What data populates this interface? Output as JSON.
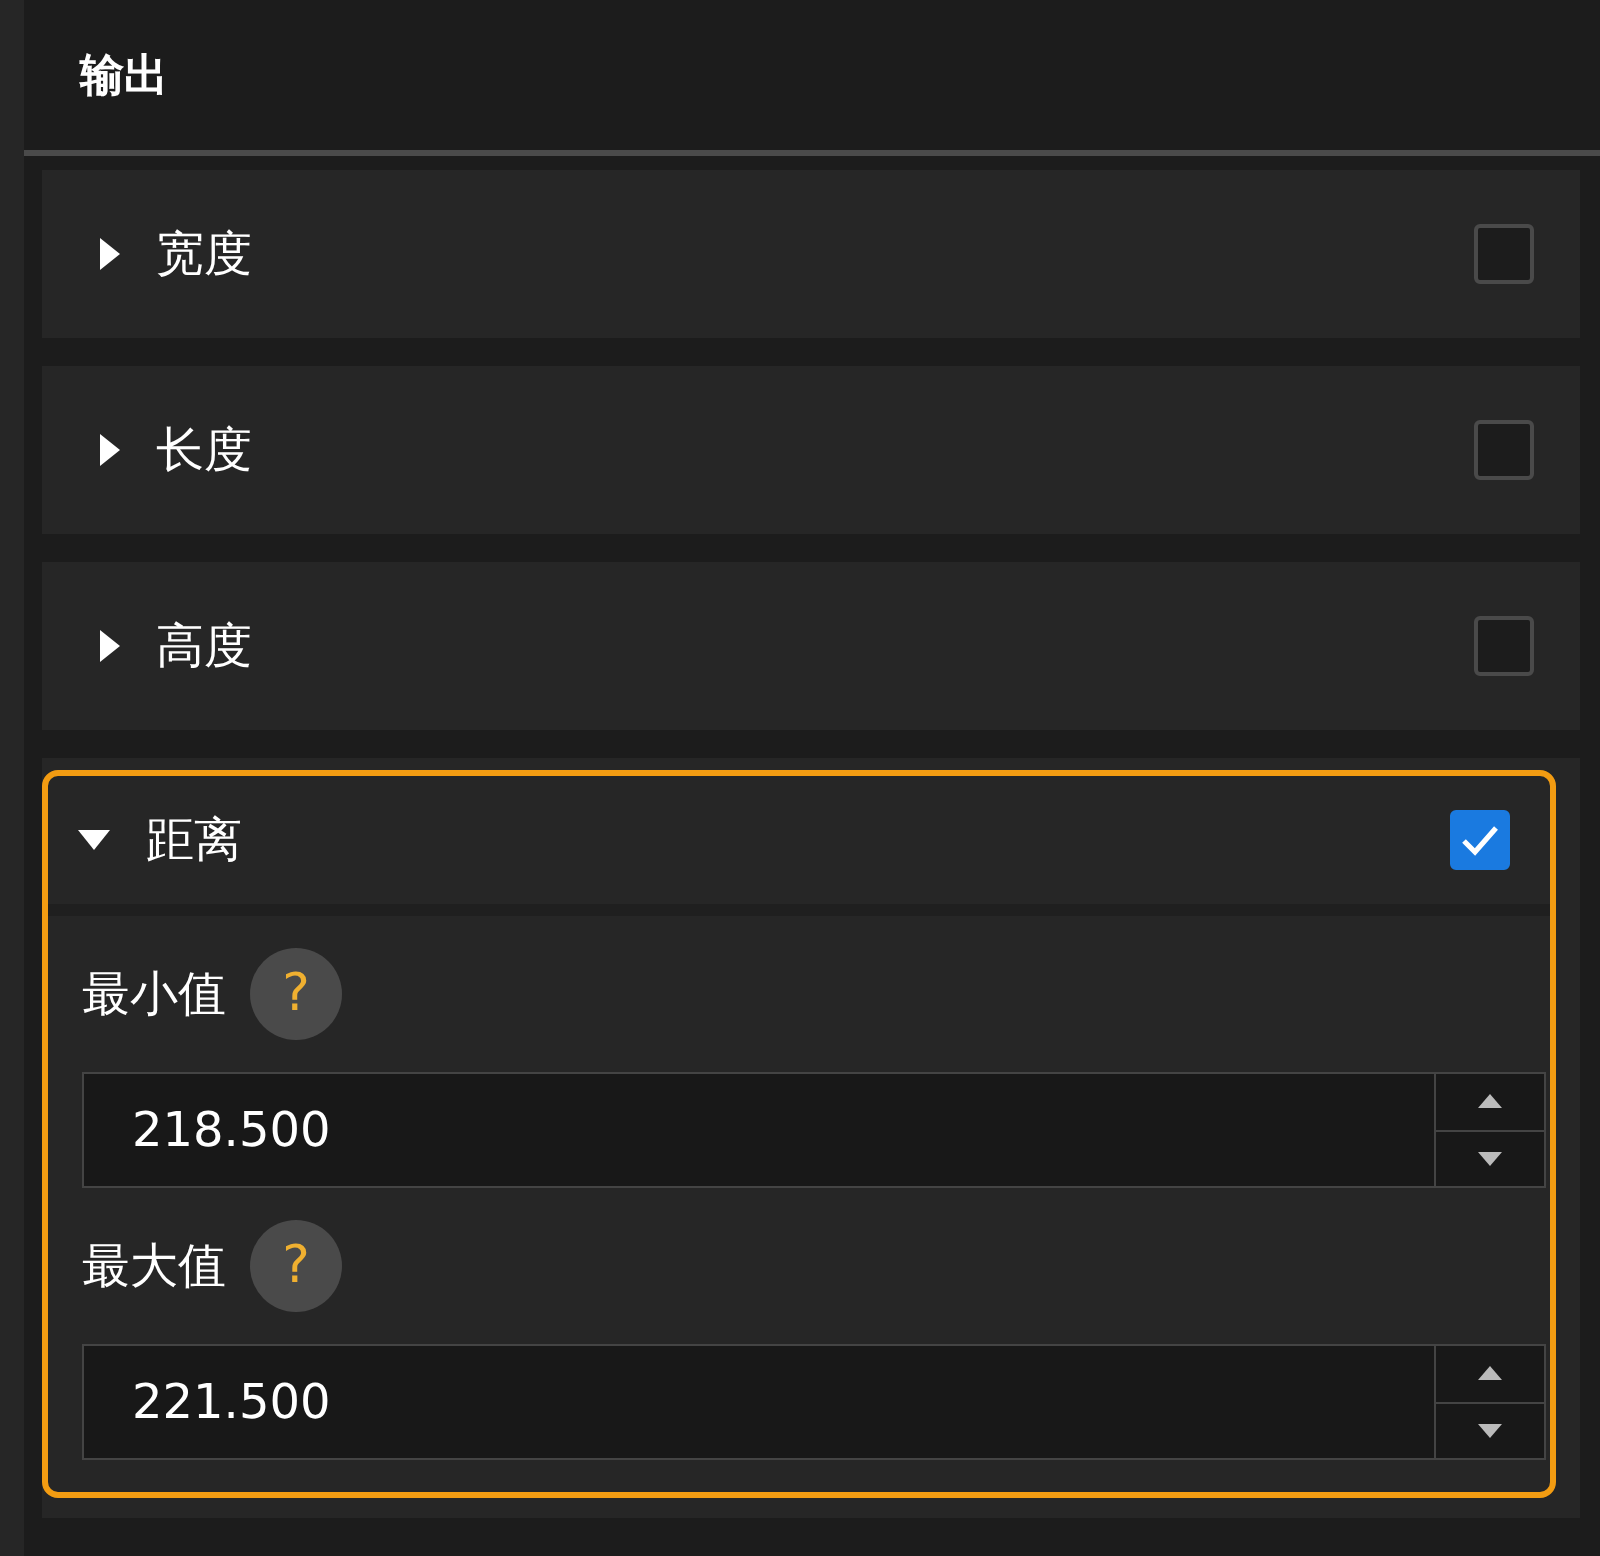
{
  "panel": {
    "title": "输出"
  },
  "sections": [
    {
      "label": "宽度",
      "expanded": false,
      "checked": false,
      "highlighted": false
    },
    {
      "label": "长度",
      "expanded": false,
      "checked": false,
      "highlighted": false
    },
    {
      "label": "高度",
      "expanded": false,
      "checked": false,
      "highlighted": false
    },
    {
      "label": "距离",
      "expanded": true,
      "checked": true,
      "highlighted": true,
      "fields": [
        {
          "label": "最小值",
          "help": "?",
          "value": "218.500"
        },
        {
          "label": "最大值",
          "help": "?",
          "value": "221.500"
        }
      ]
    }
  ]
}
